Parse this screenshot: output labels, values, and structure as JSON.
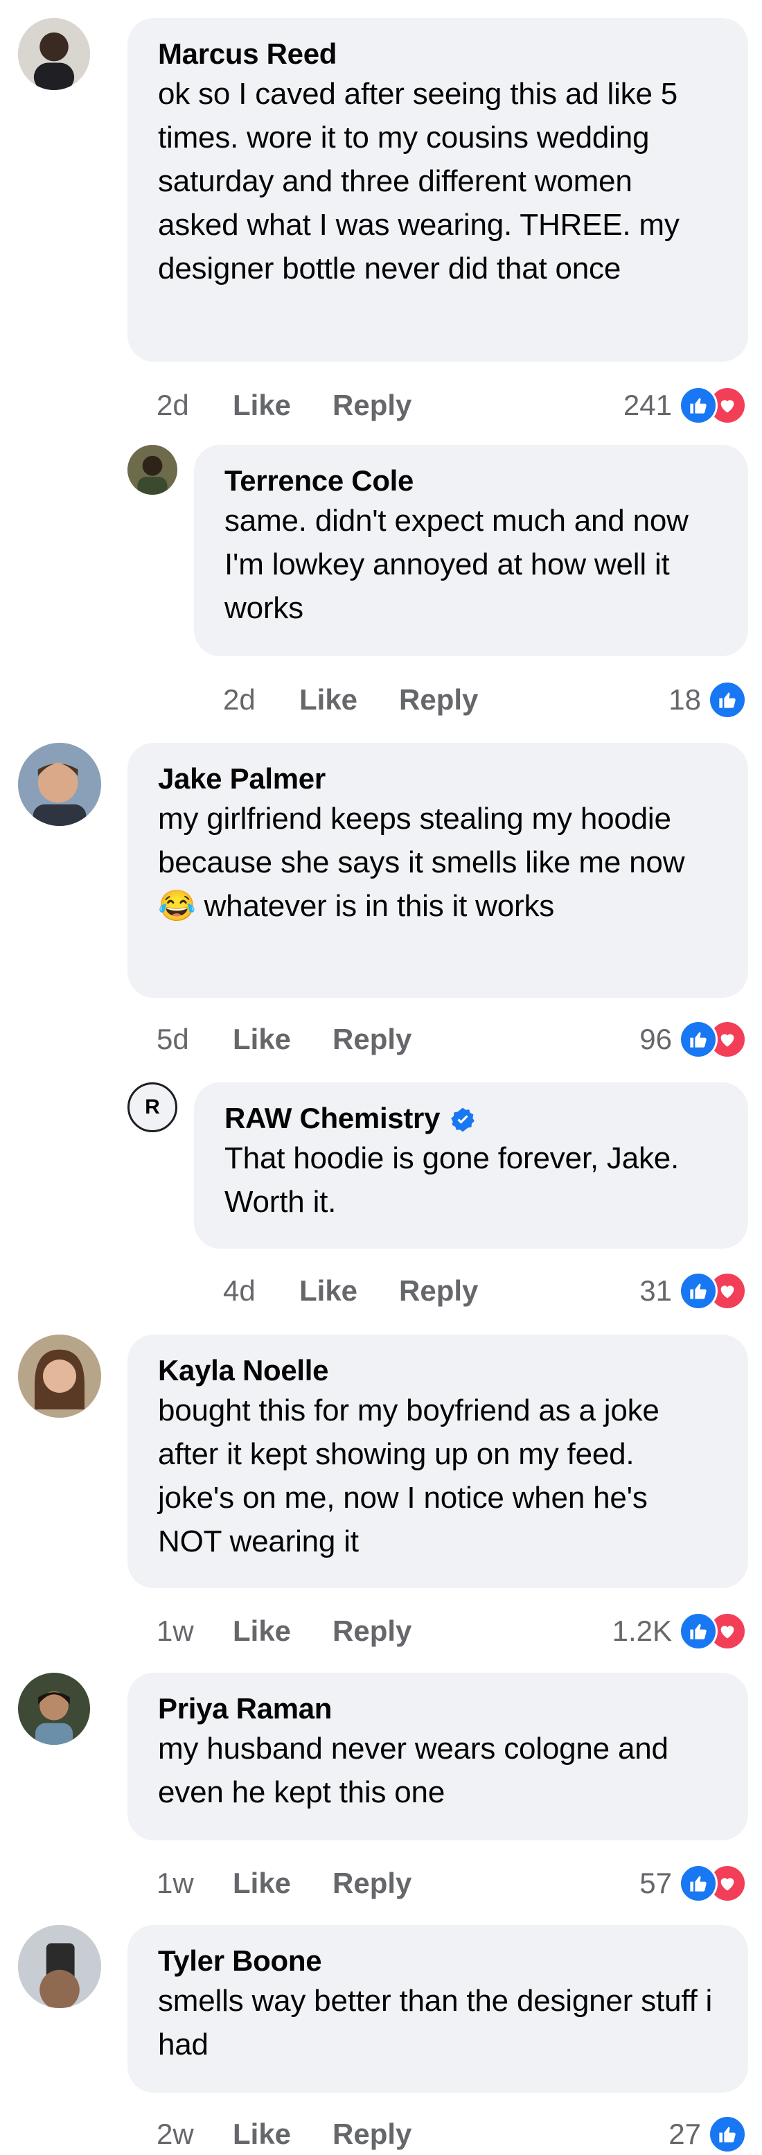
{
  "comments": [
    {
      "author": "Marcus Reed",
      "text": "ok so I caved after seeing this ad like 5 times. wore it to my cousins wedding saturday and three different women asked what I was wearing. THREE. my designer bottle never did that once",
      "time": "2d",
      "like_label": "Like",
      "reply_label": "Reply",
      "reaction_count": "241",
      "reactions": [
        "like-icon",
        "love-icon"
      ]
    },
    {
      "author": "Terrence Cole",
      "text": "same. didn't expect much and now I'm lowkey annoyed at how well it works",
      "time": "2d",
      "like_label": "Like",
      "reply_label": "Reply",
      "reaction_count": "18",
      "reactions": [
        "like-icon"
      ]
    },
    {
      "author": "Jake Palmer",
      "text": "my girlfriend keeps stealing my hoodie because she says it smells like me now 😂 whatever is in this it works",
      "time": "5d",
      "like_label": "Like",
      "reply_label": "Reply",
      "reaction_count": "96",
      "reactions": [
        "like-icon",
        "love-icon"
      ]
    },
    {
      "author": "RAW Chemistry",
      "avatar_letter": "R",
      "verified": true,
      "text": "That hoodie is gone forever, Jake. Worth it.",
      "time": "4d",
      "like_label": "Like",
      "reply_label": "Reply",
      "reaction_count": "31",
      "reactions": [
        "like-icon",
        "love-icon"
      ]
    },
    {
      "author": "Kayla Noelle",
      "text": "bought this for my boyfriend as a joke after it kept showing up on my feed. joke's on me, now I notice when he's NOT wearing it",
      "time": "1w",
      "like_label": "Like",
      "reply_label": "Reply",
      "reaction_count": "1.2K",
      "reactions": [
        "like-icon",
        "love-icon"
      ]
    },
    {
      "author": "Priya Raman",
      "text": "my husband never wears cologne and even he kept this one",
      "time": "1w",
      "like_label": "Like",
      "reply_label": "Reply",
      "reaction_count": "57",
      "reactions": [
        "like-icon",
        "love-icon"
      ]
    },
    {
      "author": "Tyler Boone",
      "text": "smells way better than the designer stuff i had",
      "time": "2w",
      "like_label": "Like",
      "reply_label": "Reply",
      "reaction_count": "27",
      "reactions": [
        "like-icon"
      ]
    }
  ],
  "colors": {
    "bubble": "#f0f2f5",
    "meta_text": "#65676b",
    "like_blue": "#1877f2",
    "love_red": "#f33e58",
    "verified_blue": "#1877f2"
  }
}
